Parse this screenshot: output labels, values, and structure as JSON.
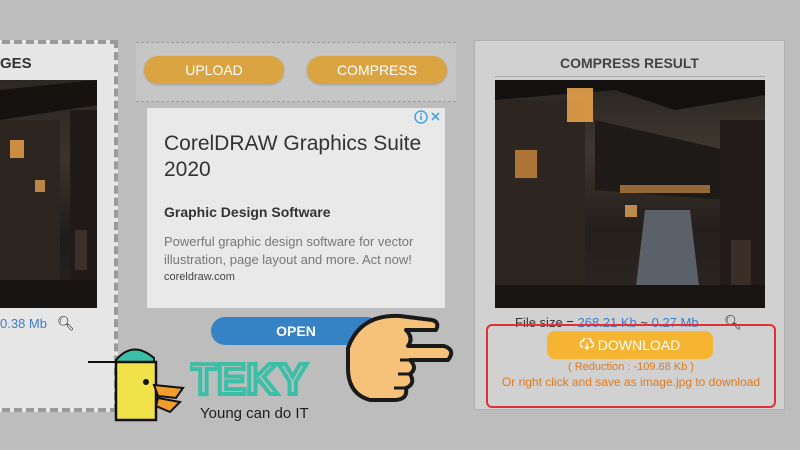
{
  "left": {
    "title": "GES",
    "size": "0.38 Mb"
  },
  "toolbar": {
    "upload_label": "UPLOAD",
    "compress_label": "COMPRESS"
  },
  "ad": {
    "title": "CorelDRAW Graphics Suite 2020",
    "subtitle": "Graphic Design Software",
    "description": "Powerful graphic design software for vector illustration, page layout and more. Act now!",
    "url": "coreldraw.com",
    "button": "OPEN"
  },
  "result": {
    "title": "COMPRESS RESULT",
    "file_size_label": "File size = ",
    "original_size": "268.21 Kb",
    "arrow": " ~ ",
    "new_size": "0.27 Mb",
    "download_label": "DOWNLOAD",
    "reduction": "( Reduction : -109.68 Kb )",
    "right_click": "Or right click and save as image.jpg to download"
  },
  "logo": {
    "brand": "TEKY",
    "tagline": "Young can do IT"
  },
  "colors": {
    "accent_gold": "#d9a441",
    "download": "#f5b431",
    "open_blue": "#3582c4",
    "highlight_red": "#e0313a",
    "logo_teal": "#3bbfa6"
  }
}
